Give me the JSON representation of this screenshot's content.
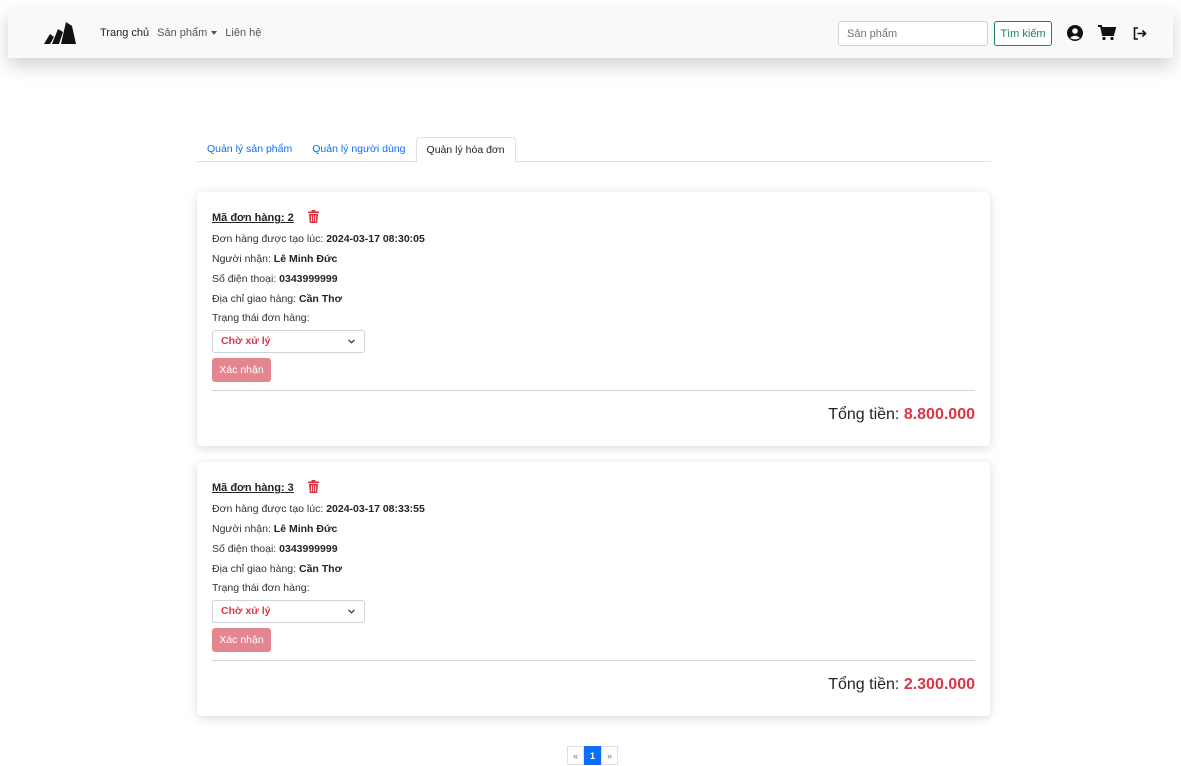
{
  "navbar": {
    "links": [
      {
        "label": "Trang chủ"
      },
      {
        "label": "Sản phẩm"
      },
      {
        "label": "Liên hệ"
      }
    ],
    "search": {
      "placeholder": "Sản phẩm",
      "value": ""
    },
    "search_button": "Tìm kiếm",
    "icons": [
      "logo-icon",
      "user-icon",
      "cart-icon",
      "logout-icon"
    ]
  },
  "tabs": [
    {
      "label": "Quản lý sản phẩm"
    },
    {
      "label": "Quản lý người dùng"
    },
    {
      "label": "Quản lý hóa đơn"
    }
  ],
  "orders": [
    {
      "title": "Mã đơn hàng: 2",
      "created_label": "Đơn hàng được tạo lúc: ",
      "created_value": "2024-03-17 08:30:05",
      "recipient_label": "Người nhận: ",
      "recipient_value": "Lê Minh Đức",
      "phone_label": "Số điện thoại: ",
      "phone_value": "0343999999",
      "address_label": "Địa chỉ giao hàng: ",
      "address_value": "Cần Thơ",
      "status_label": "Trạng thái đơn hàng:",
      "status_value": "Chờ xử lý",
      "confirm_label": "Xác nhận",
      "total_label": "Tổng tiền: ",
      "total_value": "8.800.000"
    },
    {
      "title": "Mã đơn hàng: 3",
      "created_label": "Đơn hàng được tạo lúc: ",
      "created_value": "2024-03-17 08:33:55",
      "recipient_label": "Người nhận: ",
      "recipient_value": "Lê Minh Đức",
      "phone_label": "Số điện thoại: ",
      "phone_value": "0343999999",
      "address_label": "Địa chỉ giao hàng: ",
      "address_value": "Cần Thơ",
      "status_label": "Trạng thái đơn hàng:",
      "status_value": "Chờ xử lý",
      "confirm_label": "Xác nhận",
      "total_label": "Tổng tiền: ",
      "total_value": "2.300.000"
    }
  ],
  "pagination": {
    "prev": "«",
    "current": "1",
    "next": "»"
  },
  "colors": {
    "primary": "#0d6efd",
    "danger": "#dc3545",
    "success": "#198754",
    "confirm": "#e4868f"
  }
}
